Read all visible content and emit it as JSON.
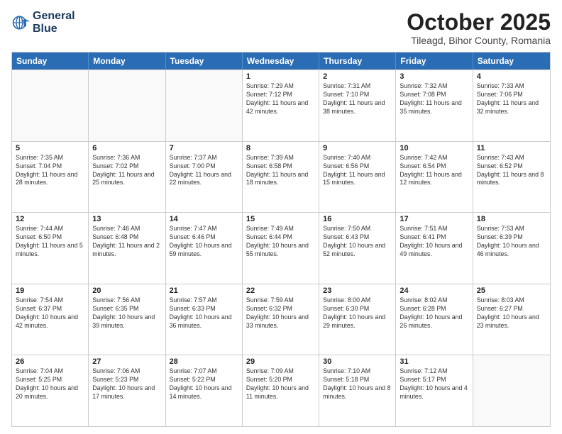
{
  "header": {
    "logo_line1": "General",
    "logo_line2": "Blue",
    "month_title": "October 2025",
    "subtitle": "Tileagd, Bihor County, Romania"
  },
  "weekdays": [
    "Sunday",
    "Monday",
    "Tuesday",
    "Wednesday",
    "Thursday",
    "Friday",
    "Saturday"
  ],
  "rows": [
    [
      {
        "day": "",
        "info": ""
      },
      {
        "day": "",
        "info": ""
      },
      {
        "day": "",
        "info": ""
      },
      {
        "day": "1",
        "info": "Sunrise: 7:29 AM\nSunset: 7:12 PM\nDaylight: 11 hours\nand 42 minutes."
      },
      {
        "day": "2",
        "info": "Sunrise: 7:31 AM\nSunset: 7:10 PM\nDaylight: 11 hours\nand 38 minutes."
      },
      {
        "day": "3",
        "info": "Sunrise: 7:32 AM\nSunset: 7:08 PM\nDaylight: 11 hours\nand 35 minutes."
      },
      {
        "day": "4",
        "info": "Sunrise: 7:33 AM\nSunset: 7:06 PM\nDaylight: 11 hours\nand 32 minutes."
      }
    ],
    [
      {
        "day": "5",
        "info": "Sunrise: 7:35 AM\nSunset: 7:04 PM\nDaylight: 11 hours\nand 28 minutes."
      },
      {
        "day": "6",
        "info": "Sunrise: 7:36 AM\nSunset: 7:02 PM\nDaylight: 11 hours\nand 25 minutes."
      },
      {
        "day": "7",
        "info": "Sunrise: 7:37 AM\nSunset: 7:00 PM\nDaylight: 11 hours\nand 22 minutes."
      },
      {
        "day": "8",
        "info": "Sunrise: 7:39 AM\nSunset: 6:58 PM\nDaylight: 11 hours\nand 18 minutes."
      },
      {
        "day": "9",
        "info": "Sunrise: 7:40 AM\nSunset: 6:56 PM\nDaylight: 11 hours\nand 15 minutes."
      },
      {
        "day": "10",
        "info": "Sunrise: 7:42 AM\nSunset: 6:54 PM\nDaylight: 11 hours\nand 12 minutes."
      },
      {
        "day": "11",
        "info": "Sunrise: 7:43 AM\nSunset: 6:52 PM\nDaylight: 11 hours\nand 8 minutes."
      }
    ],
    [
      {
        "day": "12",
        "info": "Sunrise: 7:44 AM\nSunset: 6:50 PM\nDaylight: 11 hours\nand 5 minutes."
      },
      {
        "day": "13",
        "info": "Sunrise: 7:46 AM\nSunset: 6:48 PM\nDaylight: 11 hours\nand 2 minutes."
      },
      {
        "day": "14",
        "info": "Sunrise: 7:47 AM\nSunset: 6:46 PM\nDaylight: 10 hours\nand 59 minutes."
      },
      {
        "day": "15",
        "info": "Sunrise: 7:49 AM\nSunset: 6:44 PM\nDaylight: 10 hours\nand 55 minutes."
      },
      {
        "day": "16",
        "info": "Sunrise: 7:50 AM\nSunset: 6:43 PM\nDaylight: 10 hours\nand 52 minutes."
      },
      {
        "day": "17",
        "info": "Sunrise: 7:51 AM\nSunset: 6:41 PM\nDaylight: 10 hours\nand 49 minutes."
      },
      {
        "day": "18",
        "info": "Sunrise: 7:53 AM\nSunset: 6:39 PM\nDaylight: 10 hours\nand 46 minutes."
      }
    ],
    [
      {
        "day": "19",
        "info": "Sunrise: 7:54 AM\nSunset: 6:37 PM\nDaylight: 10 hours\nand 42 minutes."
      },
      {
        "day": "20",
        "info": "Sunrise: 7:56 AM\nSunset: 6:35 PM\nDaylight: 10 hours\nand 39 minutes."
      },
      {
        "day": "21",
        "info": "Sunrise: 7:57 AM\nSunset: 6:33 PM\nDaylight: 10 hours\nand 36 minutes."
      },
      {
        "day": "22",
        "info": "Sunrise: 7:59 AM\nSunset: 6:32 PM\nDaylight: 10 hours\nand 33 minutes."
      },
      {
        "day": "23",
        "info": "Sunrise: 8:00 AM\nSunset: 6:30 PM\nDaylight: 10 hours\nand 29 minutes."
      },
      {
        "day": "24",
        "info": "Sunrise: 8:02 AM\nSunset: 6:28 PM\nDaylight: 10 hours\nand 26 minutes."
      },
      {
        "day": "25",
        "info": "Sunrise: 8:03 AM\nSunset: 6:27 PM\nDaylight: 10 hours\nand 23 minutes."
      }
    ],
    [
      {
        "day": "26",
        "info": "Sunrise: 7:04 AM\nSunset: 5:25 PM\nDaylight: 10 hours\nand 20 minutes."
      },
      {
        "day": "27",
        "info": "Sunrise: 7:06 AM\nSunset: 5:23 PM\nDaylight: 10 hours\nand 17 minutes."
      },
      {
        "day": "28",
        "info": "Sunrise: 7:07 AM\nSunset: 5:22 PM\nDaylight: 10 hours\nand 14 minutes."
      },
      {
        "day": "29",
        "info": "Sunrise: 7:09 AM\nSunset: 5:20 PM\nDaylight: 10 hours\nand 11 minutes."
      },
      {
        "day": "30",
        "info": "Sunrise: 7:10 AM\nSunset: 5:18 PM\nDaylight: 10 hours\nand 8 minutes."
      },
      {
        "day": "31",
        "info": "Sunrise: 7:12 AM\nSunset: 5:17 PM\nDaylight: 10 hours\nand 4 minutes."
      },
      {
        "day": "",
        "info": ""
      }
    ]
  ]
}
